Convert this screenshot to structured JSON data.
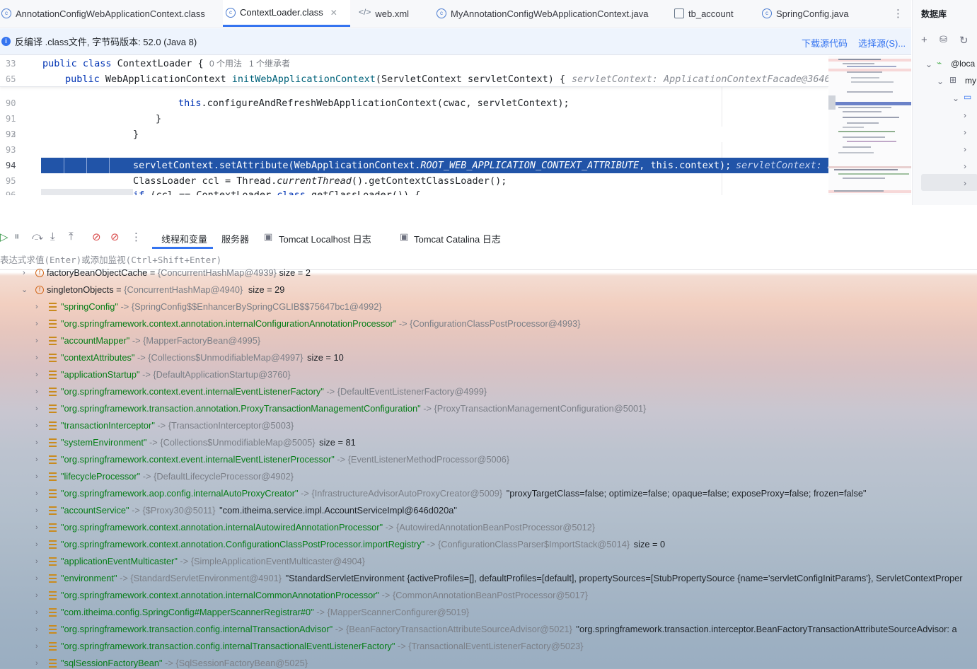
{
  "tabs": [
    {
      "label": "AnnotationConfigWebApplicationContext.class",
      "icon": "class-icon"
    },
    {
      "label": "ContextLoader.class",
      "icon": "class-icon",
      "active": true
    },
    {
      "label": "web.xml",
      "icon": "xml-icon"
    },
    {
      "label": "MyAnnotationConfigWebApplicationContext.java",
      "icon": "class-icon"
    },
    {
      "label": "tb_account",
      "icon": "table-icon"
    },
    {
      "label": "SpringConfig.java",
      "icon": "class-icon"
    }
  ],
  "database_panel": {
    "title": "数据库",
    "items": [
      "@loca",
      "my"
    ]
  },
  "banner": {
    "message": "反编译 .class文件, 字节码版本: 52.0 (Java 8)",
    "download_link": "下载源代码",
    "choose_link": "选择源(S)..."
  },
  "editor": {
    "sticky": [
      {
        "ln": "33",
        "code": "public class ContextLoader {",
        "meta": "0 个用法   1 个继承者"
      },
      {
        "ln": "65",
        "code": "public WebApplicationContext initWebApplicationContext(ServletContext servletContext) {",
        "hint": "servletContext: ApplicationContextFacade@3646"
      }
    ],
    "lines": [
      {
        "ln": "90",
        "code": "this.configureAndRefreshWebApplicationContext(cwac, servletContext);"
      },
      {
        "ln": "91",
        "code": "}"
      },
      {
        "ln": "92",
        "code": "}"
      },
      {
        "ln": "93",
        "code": ""
      },
      {
        "ln": "94",
        "code": "servletContext.setAttribute(WebApplicationContext.ROOT_WEB_APPLICATION_CONTEXT_ATTRIBUTE, this.context);",
        "hint": "servletContext: A"
      },
      {
        "ln": "95",
        "code": "ClassLoader ccl = Thread.currentThread().getContextClassLoader();"
      },
      {
        "ln": "96",
        "code": "if (ccl == ContextLoader.class.getClassLoader()) {"
      }
    ]
  },
  "debug": {
    "tabs": [
      "线程和变量",
      "服务器",
      "Tomcat Localhost 日志",
      "Tomcat Catalina 日志"
    ],
    "eval_placeholder": "表达式求值(Enter)或添加监视(Ctrl+Shift+Enter)"
  },
  "variables": {
    "partial_row": {
      "name": "factoryBeanObjectCache",
      "value": "{ConcurrentHashMap@4939}",
      "extra": "size = 2"
    },
    "parent": {
      "name": "singletonObjects",
      "value": "{ConcurrentHashMap@4940}",
      "extra": "size = 29"
    },
    "entries": [
      {
        "key": "\"springConfig\"",
        "value": "{SpringConfig$$EnhancerBySpringCGLIB$$75647bc1@4992}",
        "extra": ""
      },
      {
        "key": "\"org.springframework.context.annotation.internalConfigurationAnnotationProcessor\"",
        "value": "{ConfigurationClassPostProcessor@4993}",
        "extra": ""
      },
      {
        "key": "\"accountMapper\"",
        "value": "{MapperFactoryBean@4995}",
        "extra": ""
      },
      {
        "key": "\"contextAttributes\"",
        "value": "{Collections$UnmodifiableMap@4997}",
        "extra": "size = 10"
      },
      {
        "key": "\"applicationStartup\"",
        "value": "{DefaultApplicationStartup@3760}",
        "extra": ""
      },
      {
        "key": "\"org.springframework.context.event.internalEventListenerFactory\"",
        "value": "{DefaultEventListenerFactory@4999}",
        "extra": ""
      },
      {
        "key": "\"org.springframework.transaction.annotation.ProxyTransactionManagementConfiguration\"",
        "value": "{ProxyTransactionManagementConfiguration@5001}",
        "extra": ""
      },
      {
        "key": "\"transactionInterceptor\"",
        "value": "{TransactionInterceptor@5003}",
        "extra": ""
      },
      {
        "key": "\"systemEnvironment\"",
        "value": "{Collections$UnmodifiableMap@5005}",
        "extra": "size = 81"
      },
      {
        "key": "\"org.springframework.context.event.internalEventListenerProcessor\"",
        "value": "{EventListenerMethodProcessor@5006}",
        "extra": ""
      },
      {
        "key": "\"lifecycleProcessor\"",
        "value": "{DefaultLifecycleProcessor@4902}",
        "extra": ""
      },
      {
        "key": "\"org.springframework.aop.config.internalAutoProxyCreator\"",
        "value": "{InfrastructureAdvisorAutoProxyCreator@5009}",
        "extra": "\"proxyTargetClass=false; optimize=false; opaque=false; exposeProxy=false; frozen=false\""
      },
      {
        "key": "\"accountService\"",
        "value": "{$Proxy30@5011}",
        "extra": "\"com.itheima.service.impl.AccountServiceImpl@646d020a\""
      },
      {
        "key": "\"org.springframework.context.annotation.internalAutowiredAnnotationProcessor\"",
        "value": "{AutowiredAnnotationBeanPostProcessor@5012}",
        "extra": ""
      },
      {
        "key": "\"org.springframework.context.annotation.ConfigurationClassPostProcessor.importRegistry\"",
        "value": "{ConfigurationClassParser$ImportStack@5014}",
        "extra": "size = 0"
      },
      {
        "key": "\"applicationEventMulticaster\"",
        "value": "{SimpleApplicationEventMulticaster@4904}",
        "extra": ""
      },
      {
        "key": "\"environment\"",
        "value": "{StandardServletEnvironment@4901}",
        "extra": "\"StandardServletEnvironment {activeProfiles=[], defaultProfiles=[default], propertySources=[StubPropertySource {name='servletConfigInitParams'}, ServletContextProper"
      },
      {
        "key": "\"org.springframework.context.annotation.internalCommonAnnotationProcessor\"",
        "value": "{CommonAnnotationBeanPostProcessor@5017}",
        "extra": ""
      },
      {
        "key": "\"com.itheima.config.SpringConfig#MapperScannerRegistrar#0\"",
        "value": "{MapperScannerConfigurer@5019}",
        "extra": ""
      },
      {
        "key": "\"org.springframework.transaction.config.internalTransactionAdvisor\"",
        "value": "{BeanFactoryTransactionAttributeSourceAdvisor@5021}",
        "extra": "\"org.springframework.transaction.interceptor.BeanFactoryTransactionAttributeSourceAdvisor: a"
      },
      {
        "key": "\"org.springframework.transaction.config.internalTransactionalEventListenerFactory\"",
        "value": "{TransactionalEventListenerFactory@5023}",
        "extra": ""
      },
      {
        "key": "\"sqlSessionFactoryBean\"",
        "value": "{SqlSessionFactoryBean@5025}",
        "extra": ""
      }
    ]
  }
}
